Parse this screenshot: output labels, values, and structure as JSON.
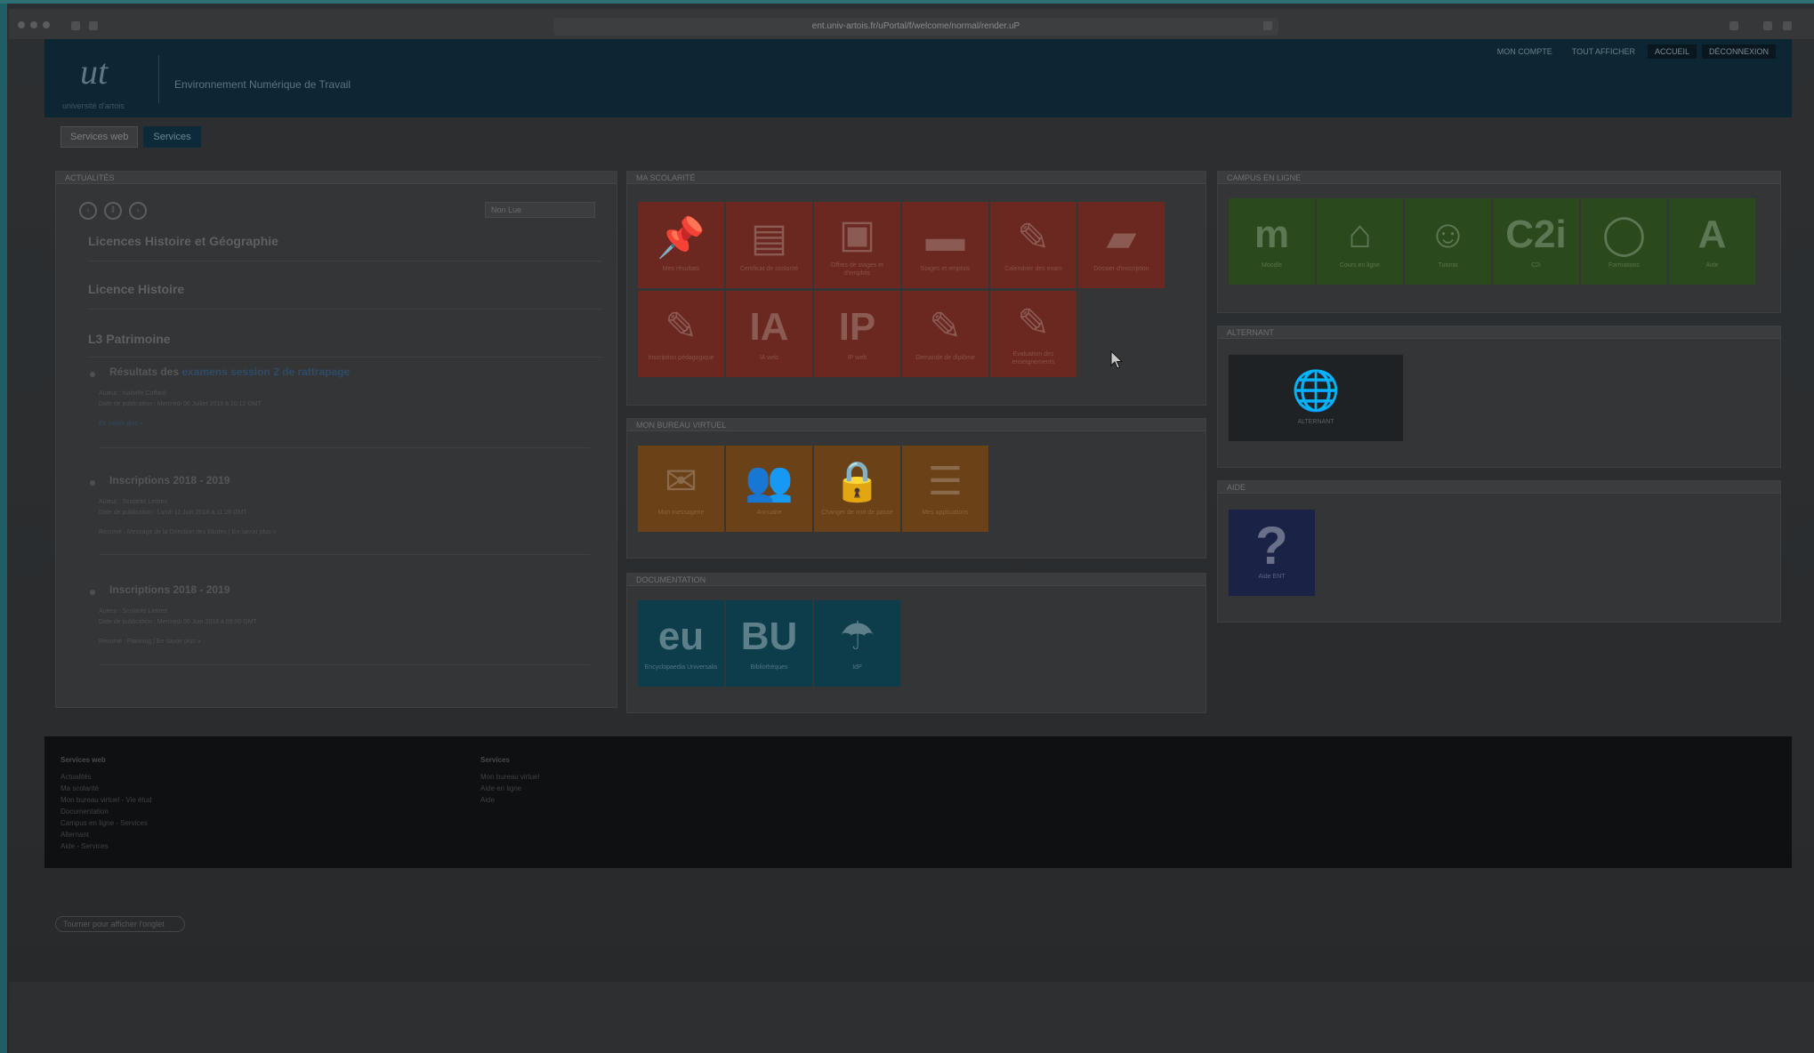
{
  "browser": {
    "url": "ent.univ-artois.fr/uPortal/f/welcome/normal/render.uP"
  },
  "header": {
    "logo_text": "ut",
    "logo_sub": "université d'artois",
    "site_title": "Environnement Numérique de Travail",
    "top_links": [
      "MON COMPTE",
      "TOUT AFFICHER",
      "ACCUEIL",
      "DÉCONNEXION"
    ]
  },
  "tabs": [
    "Services web",
    "Services"
  ],
  "news": {
    "head": "ACTUALITÉS",
    "select_value": "Non Lue",
    "categories": [
      "Licences Histoire et Géographie",
      "Licence Histoire",
      "L3 Patrimoine"
    ],
    "items": [
      {
        "title_prefix": "Résultats des ",
        "title_link": "examens session 2 de rattrapage",
        "meta1": "Auteur : Isabelle Coffard",
        "meta2": "Date de publication : Mercredi 06 Juillet 2018 à 10:12 GMT",
        "more": "En savoir plus »"
      },
      {
        "title_prefix": "Inscriptions 2018 - 2019",
        "title_link": "",
        "meta1": "Auteur : Scolarité Lettres",
        "meta2": "Date de publication : Lundi 11 Juin 2018 à 11:28 GMT",
        "more": "Résumé : Message de la Direction des Etudes | En savoir plus »"
      },
      {
        "title_prefix": "Inscriptions 2018 - 2019",
        "title_link": "",
        "meta1": "Auteur : Scolarité Lettres",
        "meta2": "Date de publication : Mercredi 06 Juin 2018 à 09:00 GMT",
        "more": "Résumé : Planning | En savoir plus »"
      }
    ]
  },
  "mes_resultats": {
    "head": "MA SCOLARITÉ",
    "tiles": [
      {
        "icon": "pin-icon",
        "glyph": "📌",
        "label": "Mes résultats"
      },
      {
        "icon": "document-icon",
        "glyph": "▤",
        "label": "Certificat de scolarité"
      },
      {
        "icon": "briefcase-ut-icon",
        "glyph": "▣",
        "label": "Offres de stages et d'emplois"
      },
      {
        "icon": "briefcase-icon",
        "glyph": "▬",
        "label": "Stages et emplois"
      },
      {
        "icon": "exam-icon",
        "glyph": "✎",
        "label": "Calendrier des exam"
      },
      {
        "icon": "folder-icon",
        "glyph": "▰",
        "label": "Dossier d'inscription"
      },
      {
        "icon": "edit-icon",
        "glyph": "✎",
        "label": "Inscription pédagogique"
      },
      {
        "icon": "ia-icon",
        "glyph": "IA",
        "label": "IA web"
      },
      {
        "icon": "ip-icon",
        "glyph": "IP",
        "label": "IP web"
      },
      {
        "icon": "diploma-icon",
        "glyph": "✎",
        "label": "Demande de diplôme"
      },
      {
        "icon": "edit2-icon",
        "glyph": "✎",
        "label": "Evaluation des enseignements"
      }
    ]
  },
  "mon_bureau": {
    "head": "MON BUREAU VIRTUEL",
    "tiles": [
      {
        "icon": "mail-icon",
        "glyph": "✉",
        "label": "Mon messagerie"
      },
      {
        "icon": "contacts-icon",
        "glyph": "👥",
        "label": "Annuaire"
      },
      {
        "icon": "lock-icon",
        "glyph": "🔒",
        "label": "Changer de mot de passe"
      },
      {
        "icon": "list-icon",
        "glyph": "☰",
        "label": "Mes applications"
      }
    ]
  },
  "documentation": {
    "head": "DOCUMENTATION",
    "tiles": [
      {
        "icon": "eu-icon",
        "glyph": "eu",
        "label": "Encyclopaedia Universalis"
      },
      {
        "icon": "bu-icon",
        "glyph": "BU",
        "label": "Bibliothèques"
      },
      {
        "icon": "idp-icon",
        "glyph": "☂",
        "label": "IdP"
      }
    ]
  },
  "campus": {
    "head": "CAMPUS EN LIGNE",
    "tiles": [
      {
        "icon": "moodle-icon",
        "glyph": "m",
        "label": "Moodle"
      },
      {
        "icon": "school-icon",
        "glyph": "⌂",
        "label": "Cours en ligne"
      },
      {
        "icon": "tutor-icon",
        "glyph": "☺",
        "label": "Tutorat"
      },
      {
        "icon": "c2i-icon",
        "glyph": "C2i",
        "label": "C2i"
      },
      {
        "icon": "cnil-icon",
        "glyph": "◯",
        "label": "Formations"
      },
      {
        "icon": "a-icon",
        "glyph": "A",
        "label": "Aide"
      }
    ]
  },
  "alt": {
    "head": "ALTERNANT",
    "tile": {
      "icon": "globe-icon",
      "glyph": "🌐",
      "label": "ALTERNANT"
    }
  },
  "aide": {
    "head": "AIDE",
    "tile": {
      "icon": "question-icon",
      "glyph": "?",
      "label": "Aide ENT"
    }
  },
  "footer": {
    "col1": {
      "head": "Services web",
      "links": [
        "Actualités",
        "Ma scolarité",
        "Mon bureau virtuel - Vie étud",
        "Documentation",
        "Campus en ligne - Services",
        "Alternant",
        "Aide - Services"
      ]
    },
    "col2": {
      "head": "Services",
      "links": [
        "Mon bureau virtuel",
        "Aide en ligne",
        "Aide"
      ]
    }
  },
  "bottom_button": "Tourner pour afficher l'onglet"
}
